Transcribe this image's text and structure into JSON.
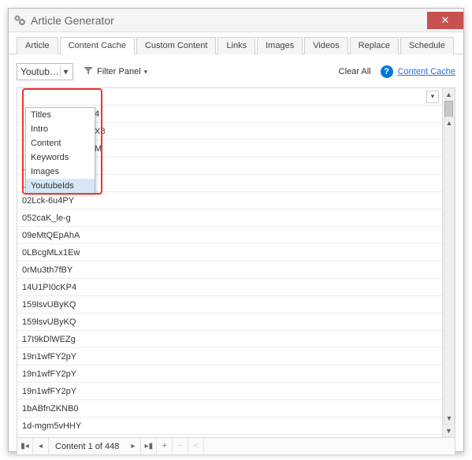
{
  "window": {
    "title": "Article Generator"
  },
  "tabs": [
    {
      "label": "Article"
    },
    {
      "label": "Content Cache"
    },
    {
      "label": "Custom Content"
    },
    {
      "label": "Links"
    },
    {
      "label": "Images"
    },
    {
      "label": "Videos"
    },
    {
      "label": "Replace"
    },
    {
      "label": "Schedule"
    }
  ],
  "toolbar": {
    "dropdown_value": "Youtub…",
    "filter_label": "Filter Panel",
    "clear_all": "Clear All",
    "content_cache_link": "Content Cache"
  },
  "dropdown_options": [
    "Titles",
    "Intro",
    "Content",
    "Keywords",
    "Images",
    "YoutubeIds"
  ],
  "grid_rows_visible": [
    "4",
    "X8",
    "M",
    "_SkqTPQGAtE",
    "_UkPoFMfnp0",
    "02Lck-6u4PY",
    "052caK_le-g",
    "09eMtQEpAhA",
    "0LBcgMLx1Ew",
    "0rMu3th7fBY",
    "14U1PI0cKP4",
    "159lsvUByKQ",
    "159lsvUByKQ",
    "17I9kDlWEZg",
    "19n1wfFY2pY",
    "19n1wfFY2pY",
    "19n1wfFY2pY",
    "1bABfnZKNB0",
    "1d-mgm5vHHY"
  ],
  "statusbar": {
    "text": "Content 1 of 448"
  }
}
